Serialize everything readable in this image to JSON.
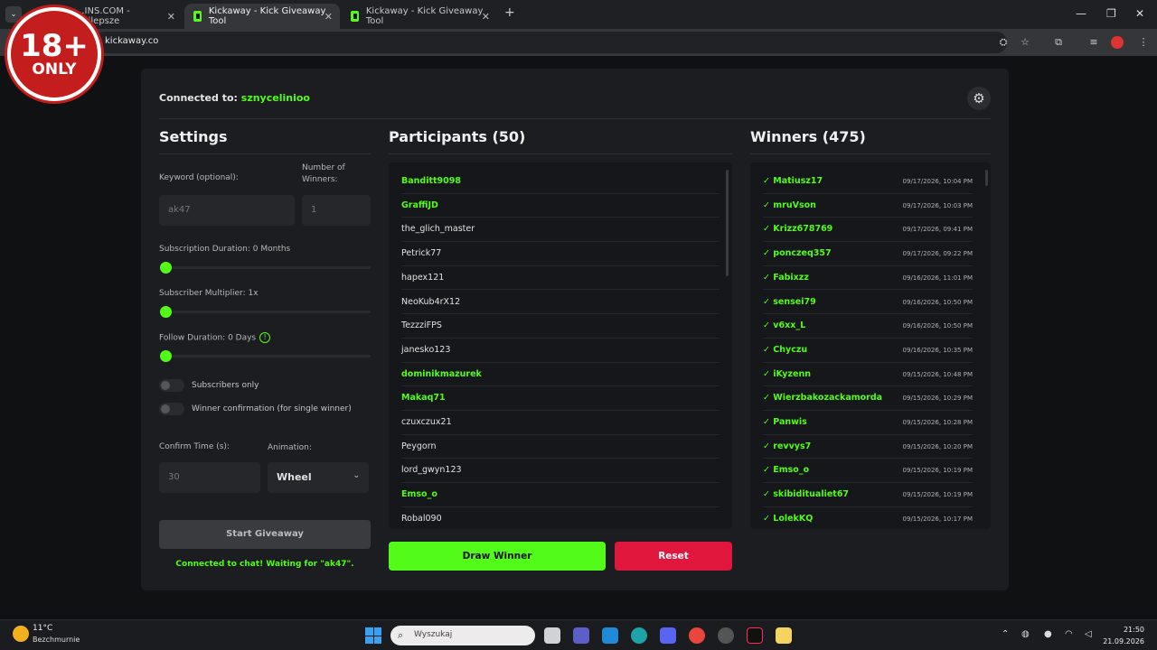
{
  "browser": {
    "tabs": [
      {
        "label": "...INS.COM - Najlepsze",
        "active": false
      },
      {
        "label": "Kickaway - Kick Giveaway Tool",
        "active": true
      },
      {
        "label": "Kickaway - Kick Giveaway Tool",
        "active": false
      }
    ],
    "url": "kickaway.co"
  },
  "overlay": {
    "age": "18+",
    "only": "ONLY"
  },
  "app": {
    "connected_label": "Connected to:",
    "channel": "sznycelinioo",
    "settings": {
      "title": "Settings",
      "keyword_label": "Keyword (optional):",
      "keyword_value": "ak47",
      "winners_label": "Number of Winners:",
      "winners_value": "1",
      "sub_duration_label": "Subscription Duration: 0 Months",
      "sub_multiplier_label": "Subscriber Multiplier: 1x",
      "follow_duration_label": "Follow Duration:  0  Days",
      "subscribers_only_label": "Subscribers only",
      "winner_confirmation_label": "Winner confirmation (for single winner)",
      "confirm_time_label": "Confirm Time (s):",
      "confirm_time_value": "30",
      "animation_label": "Animation:",
      "animation_value": "Wheel",
      "start_button": "Start Giveaway",
      "status": "Connected to chat! Waiting for \"ak47\"."
    },
    "participants": {
      "title": "Participants (50)",
      "items": [
        {
          "name": "Banditt9098",
          "highlight": true
        },
        {
          "name": "GraffiJD",
          "highlight": true
        },
        {
          "name": "the_glich_master",
          "highlight": false
        },
        {
          "name": "Petrick77",
          "highlight": false
        },
        {
          "name": "hapex121",
          "highlight": false
        },
        {
          "name": "NeoKub4rX12",
          "highlight": false
        },
        {
          "name": "TezzziFPS",
          "highlight": false
        },
        {
          "name": "janesko123",
          "highlight": false
        },
        {
          "name": "dominikmazurek",
          "highlight": true
        },
        {
          "name": "Makaq71",
          "highlight": true
        },
        {
          "name": "czuxczux21",
          "highlight": false
        },
        {
          "name": "Peygorn",
          "highlight": false
        },
        {
          "name": "lord_gwyn123",
          "highlight": false
        },
        {
          "name": "Emso_o",
          "highlight": true
        },
        {
          "name": "Robal090",
          "highlight": false
        }
      ]
    },
    "winners": {
      "title": "Winners (475)",
      "items": [
        {
          "name": "✓ Matiusz17",
          "date": "09/17/2026, 10:04 PM"
        },
        {
          "name": "✓ mruVson",
          "date": "09/17/2026, 10:03 PM"
        },
        {
          "name": "✓ Krizz678769",
          "date": "09/17/2026, 09:41 PM"
        },
        {
          "name": "✓ ponczeq357",
          "date": "09/17/2026, 09:22 PM"
        },
        {
          "name": "✓ Fabixzz",
          "date": "09/16/2026, 11:01 PM"
        },
        {
          "name": "✓ sensei79",
          "date": "09/16/2026, 10:50 PM"
        },
        {
          "name": "✓ v6xx_L",
          "date": "09/16/2026, 10:50 PM"
        },
        {
          "name": "✓ Chyczu",
          "date": "09/16/2026, 10:35 PM"
        },
        {
          "name": "✓ iKyzenn",
          "date": "09/15/2026, 10:48 PM"
        },
        {
          "name": "✓ Wierzbakozackamorda",
          "date": "09/15/2026, 10:29 PM"
        },
        {
          "name": "✓ Panwis",
          "date": "09/15/2026, 10:28 PM"
        },
        {
          "name": "✓ revvys7",
          "date": "09/15/2026, 10:20 PM"
        },
        {
          "name": "✓ Emso_o",
          "date": "09/15/2026, 10:19 PM"
        },
        {
          "name": "✓ skibiditualiet67",
          "date": "09/15/2026, 10:19 PM"
        },
        {
          "name": "✓ LolekKQ",
          "date": "09/15/2026, 10:17 PM"
        }
      ]
    },
    "draw_button": "Draw Winner",
    "reset_button": "Reset",
    "accent": "#53fc18",
    "danger": "#e0163c"
  },
  "taskbar": {
    "temp": "11°C",
    "weather": "Bezchmurnie",
    "search_placeholder": "Wyszukaj",
    "time": "21:50",
    "date": "21.09.2026"
  }
}
